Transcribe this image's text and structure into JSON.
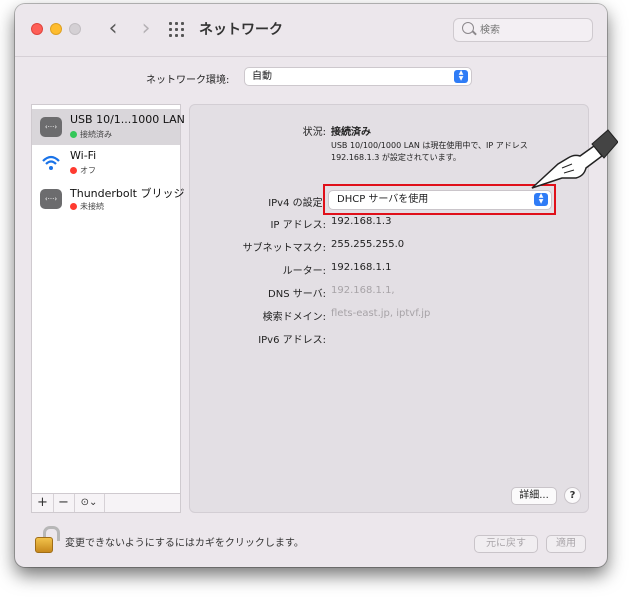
{
  "window": {
    "title": "ネットワーク",
    "search_placeholder": "検索"
  },
  "location": {
    "label": "ネットワーク環境:",
    "value": "自動"
  },
  "services": [
    {
      "name": "USB 10/1...1000 LAN",
      "status": "接続済み",
      "status_color": "#34c759",
      "icon": "ethernet-icon",
      "selected": true
    },
    {
      "name": "Wi-Fi",
      "status": "オフ",
      "status_color": "#ff3b30",
      "icon": "wifi-icon",
      "selected": false
    },
    {
      "name": "Thunderbolt ブリッジ",
      "status": "未接続",
      "status_color": "#ff3b30",
      "icon": "ethernet-icon",
      "selected": false
    }
  ],
  "sidebar_tools": {
    "add": "+",
    "remove": "−",
    "more": "⊙⌄"
  },
  "detail": {
    "status_label": "状況:",
    "status_value": "接続済み",
    "description": "USB 10/100/1000 LAN は現在使用中で、IP アドレス 192.168.1.3 が設定されています。",
    "ipv4_label": "IPv4 の設定:",
    "ipv4_value": "DHCP サーバを使用",
    "ip_label": "IP アドレス:",
    "ip_value": "192.168.1.3",
    "subnet_label": "サブネットマスク:",
    "subnet_value": "255.255.255.0",
    "router_label": "ルーター:",
    "router_value": "192.168.1.1",
    "dns_label": "DNS サーバ:",
    "dns_value": "192.168.1.1,",
    "search_domain_label": "検索ドメイン:",
    "search_domain_value": "flets-east.jp, iptvf.jp",
    "ipv6_label": "IPv6 アドレス:"
  },
  "buttons": {
    "advanced": "詳細...",
    "help": "?",
    "revert": "元に戻す",
    "apply": "適用"
  },
  "lock_text": "変更できないようにするにはカギをクリックします。",
  "colors": {
    "accent": "#2f7cf6",
    "highlight": "#e0101a"
  }
}
